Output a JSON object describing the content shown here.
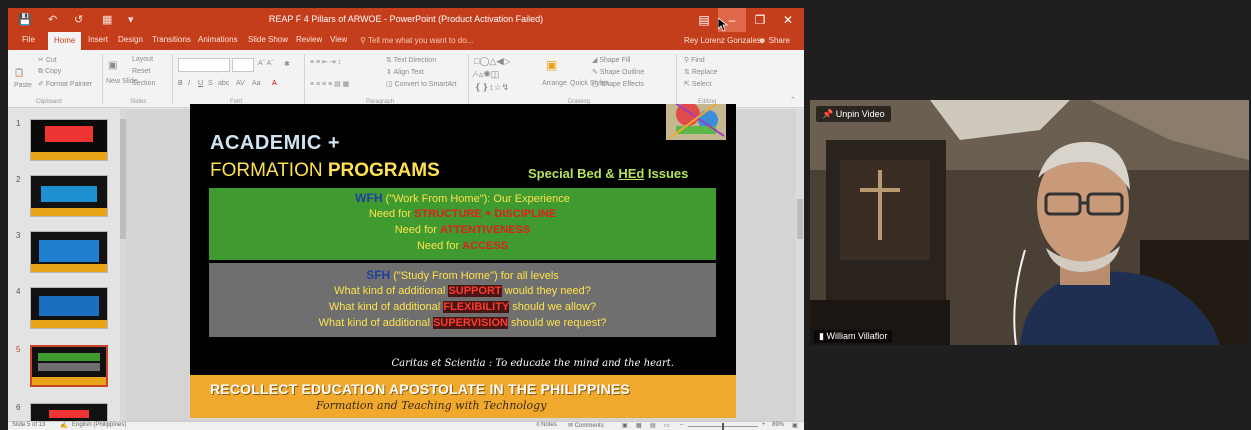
{
  "window": {
    "title": "REAP F 4 Pillars of  ARWOE - PowerPoint (Product Activation Failed)",
    "tabs": [
      "File",
      "Home",
      "Insert",
      "Design",
      "Transitions",
      "Animations",
      "Slide Show",
      "Review",
      "View"
    ],
    "active_tab": "Home",
    "tell_me": "Tell me what you want to do...",
    "user": "Rey Lorenz Gonzales",
    "share": "Share",
    "accent": "#c43e1c"
  },
  "ribbon": {
    "clipboard": {
      "cut": "Cut",
      "copy": "Copy",
      "format_painter": "Format Painter",
      "paste": "Paste",
      "label": "Clipboard"
    },
    "slides": {
      "new_slide": "New Slide",
      "layout": "Layout",
      "reset": "Reset",
      "section": "Section",
      "label": "Slides"
    },
    "font": {
      "label": "Font"
    },
    "paragraph": {
      "text_direction": "Text Direction",
      "align_text": "Align Text",
      "convert": "Convert to SmartArt",
      "label": "Paragraph"
    },
    "drawing": {
      "arrange": "Arrange",
      "quick_styles": "Quick Styles",
      "shape_fill": "Shape Fill",
      "shape_outline": "Shape Outline",
      "shape_effects": "Shape Effects",
      "label": "Drawing"
    },
    "editing": {
      "find": "Find",
      "replace": "Replace",
      "select": "Select",
      "label": "Editing"
    }
  },
  "thumbnails": [
    "1",
    "2",
    "3",
    "4",
    "5",
    "6"
  ],
  "selected_slide": "5",
  "slide": {
    "title_line1": "ACADEMIC +",
    "title_line2_a": "FORMATION ",
    "title_line2_b": "PROGRAMS",
    "special_a": "Special Bed & ",
    "special_b": "HEd",
    "special_c": " Issues",
    "wfh": {
      "head_a": "WFH",
      "head_b": " (\"Work From Home\"): Our Experience",
      "line1_a": "Need for ",
      "line1_b": "STRUCTURE + DISCIPLINE",
      "line2_a": "Need for ",
      "line2_b": "ATTENTIVENESS",
      "line3_a": "Need for ",
      "line3_b": "ACCESS"
    },
    "sfh": {
      "head_a": "SFH",
      "head_b": " (\"Study From Home\") for all levels",
      "line1_a": "What kind of additional ",
      "line1_b": "SUPPORT",
      "line1_c": " would they need?",
      "line2_a": "What kind of additional ",
      "line2_b": "FLEXIBILITY",
      "line2_c": " should we allow?",
      "line3_a": "What kind of additional ",
      "line3_b": "SUPERVISION",
      "line3_c": " should we request?"
    },
    "motto": "Caritas et Scientia : To educate the mind and the heart.",
    "footer_title": "RECOLLECT EDUCATION APOSTOLATE IN THE PHILIPPINES",
    "footer_sub": "Formation and Teaching with Technology"
  },
  "status": {
    "slide_of": "Slide 5 of 13",
    "language": "English (Philippines)",
    "notes": "Notes",
    "comments": "Comments",
    "zoom": "89%"
  },
  "video": {
    "unpin": "Unpin Video",
    "participant": "William Villaflor"
  }
}
